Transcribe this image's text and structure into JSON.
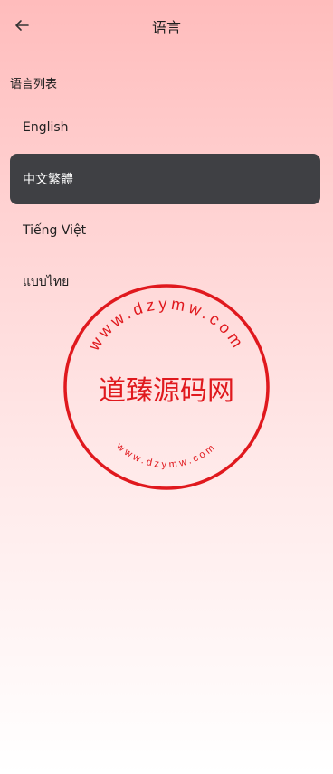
{
  "header": {
    "title": "语言",
    "back_icon": "arrow-left-icon"
  },
  "section": {
    "title": "语言列表"
  },
  "languages": [
    {
      "label": "English",
      "selected": false
    },
    {
      "label": "中文繁體",
      "selected": true
    },
    {
      "label": "Tiếng Việt",
      "selected": false
    },
    {
      "label": "แบบไทย",
      "selected": false
    }
  ],
  "watermark": {
    "center_text": "道臻源码网",
    "top_ring": "www.dzymw.com",
    "bottom_ring": "www.dzymw.com",
    "color": "#e0191e"
  },
  "colors": {
    "selected_bg": "#3f4044",
    "gradient_top": "#ffbcbc",
    "gradient_bottom": "#ffffff"
  }
}
